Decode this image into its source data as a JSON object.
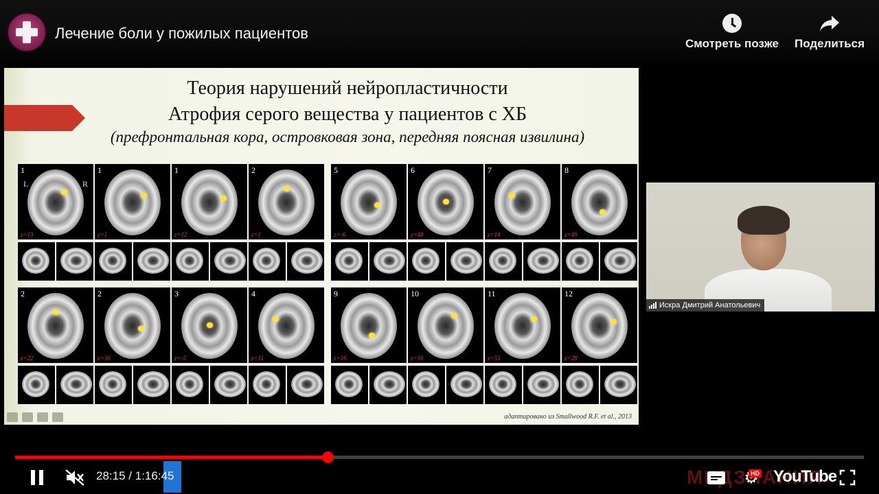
{
  "header": {
    "channel_logo": "medical-cross-logo",
    "title": "Лечение боли у пожилых пациентов",
    "watch_later_label": "Смотреть позже",
    "share_label": "Поделиться"
  },
  "slide": {
    "title_line1": "Теория нарушений нейропластичности",
    "title_line2": "Атрофия серого вещества у пациентов с ХБ",
    "subtitle": "(префронтальная кора, островковая зона, передняя поясная извилина)",
    "citation": "адаптировано из Smallwood R.F. et al., 2013",
    "top_row_numbers": [
      "1",
      "1",
      "1",
      "2",
      "5",
      "6",
      "7",
      "8"
    ],
    "top_row_z": [
      "z=13",
      "z=1",
      "z=12",
      "z=1",
      "z=-6",
      "z=48",
      "z=14",
      "z=49"
    ],
    "bottom_row_numbers": [
      "2",
      "2",
      "3",
      "4",
      "9",
      "10",
      "11",
      "12"
    ],
    "bottom_row_z": [
      "z=22",
      "z=30",
      "z=-5",
      "z=11",
      "z=16",
      "z=56",
      "z=53",
      "z=28"
    ],
    "left_label": "L",
    "right_label": "R"
  },
  "webcam": {
    "speaker_name": "Искра Дмитрий Анатольевич"
  },
  "player": {
    "current_time": "28:15",
    "separator": "/",
    "duration": "1:16:45",
    "progress_fraction": 0.368,
    "buffered_fraction": 0.368,
    "watermark_text": "МЕДЗНАНИЯ",
    "hd_badge": "HD",
    "brand": "YouTube"
  },
  "colors": {
    "progress": "#ff0000",
    "slide_arrow": "#c8382a",
    "highlight": "#ffe23a"
  }
}
